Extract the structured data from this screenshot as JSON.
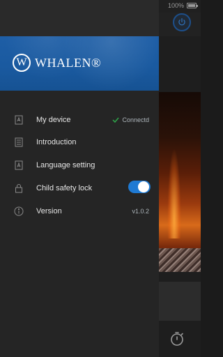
{
  "status_bar": {
    "battery_text": "100%"
  },
  "brand": {
    "logo_mark": "W",
    "logo_text": "WHALEN®"
  },
  "drawer": {
    "items": [
      {
        "label": "My device",
        "icon": "device-icon",
        "status": "Connectd"
      },
      {
        "label": "Introduction",
        "icon": "document-icon"
      },
      {
        "label": "Language setting",
        "icon": "language-icon"
      },
      {
        "label": "Child safety lock",
        "icon": "lock-icon",
        "toggle": true
      },
      {
        "label": "Version",
        "icon": "info-icon",
        "value": "v1.0.2"
      }
    ]
  },
  "colors": {
    "accent": "#1f7ad3",
    "banner": "#1a5aa0",
    "check": "#2ea84a"
  },
  "background_icons": [
    "power-icon",
    "timer-icon"
  ]
}
